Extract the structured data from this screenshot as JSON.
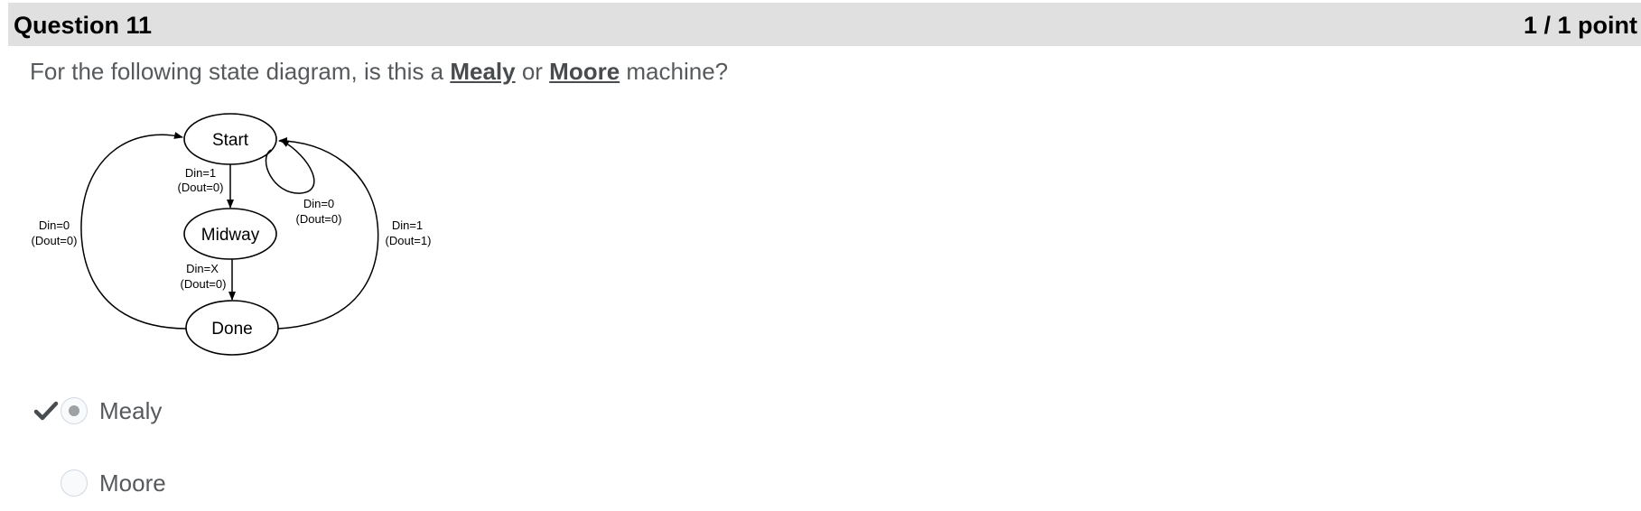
{
  "question": {
    "title": "Question 11",
    "points": "1 / 1 point",
    "prompt_before": "For the following state diagram, is this a ",
    "keyword_mealy": "Mealy",
    "prompt_or": " or ",
    "keyword_moore": "Moore",
    "prompt_after": " machine?"
  },
  "diagram": {
    "states": {
      "start": "Start",
      "midway": "Midway",
      "done": "Done"
    },
    "transitions": {
      "start_to_midway": [
        "Din=1",
        "(Dout=0)"
      ],
      "start_self": [
        "Din=0",
        "(Dout=0)"
      ],
      "midway_to_done": [
        "Din=X",
        "(Dout=0)"
      ],
      "done_to_start_left": [
        "Din=0",
        "(Dout=0)"
      ],
      "done_to_start_right": [
        "Din=1",
        "(Dout=1)"
      ]
    }
  },
  "options": [
    {
      "label": "Mealy",
      "selected": true,
      "correct": true
    },
    {
      "label": "Moore",
      "selected": false,
      "correct": false
    }
  ],
  "icons": {
    "correct": "checkmark-icon"
  },
  "colors": {
    "header_bg": "#e0e0e0",
    "text": "#565a5c",
    "radio_dot": "#9ea1a4",
    "check": "#494c4e"
  }
}
